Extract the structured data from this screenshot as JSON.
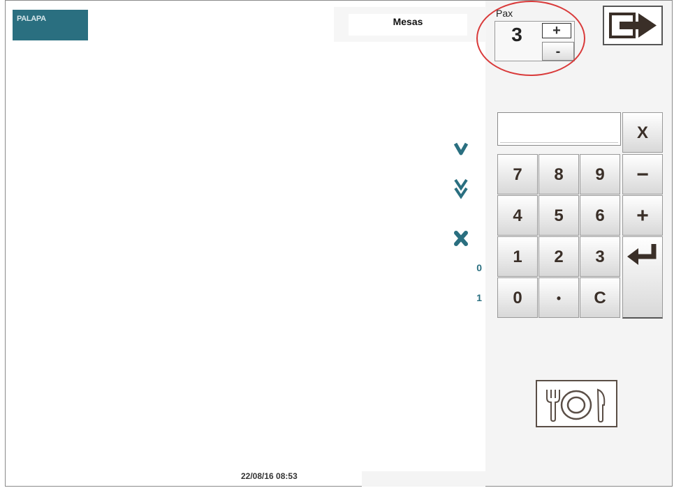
{
  "logo": {
    "text": "PALAPA"
  },
  "mesas": {
    "label": "Mesas"
  },
  "pax": {
    "label": "Pax",
    "value": "3",
    "plus": "+",
    "minus": "-"
  },
  "side_controls": {
    "count_a": "0",
    "count_b": "1"
  },
  "keypad": {
    "keys": [
      "7",
      "8",
      "9",
      "4",
      "5",
      "6",
      "1",
      "2",
      "3",
      "0",
      "•",
      "C"
    ],
    "clear": "X",
    "minus": "−",
    "plus": "+"
  },
  "status": {
    "datetime": "22/08/16 08:53"
  },
  "icons": {
    "exit": "exit-arrow-icon",
    "scroll_down": "chevron-down-icon",
    "scroll_page_down": "double-chevron-down-icon",
    "delete": "close-x-icon",
    "enter": "enter-return-icon",
    "plate": "plate-cutlery-icon"
  },
  "colors": {
    "accent": "#2a6f80",
    "highlight_circle": "#d93a3a",
    "key_text": "#3a2f28"
  }
}
